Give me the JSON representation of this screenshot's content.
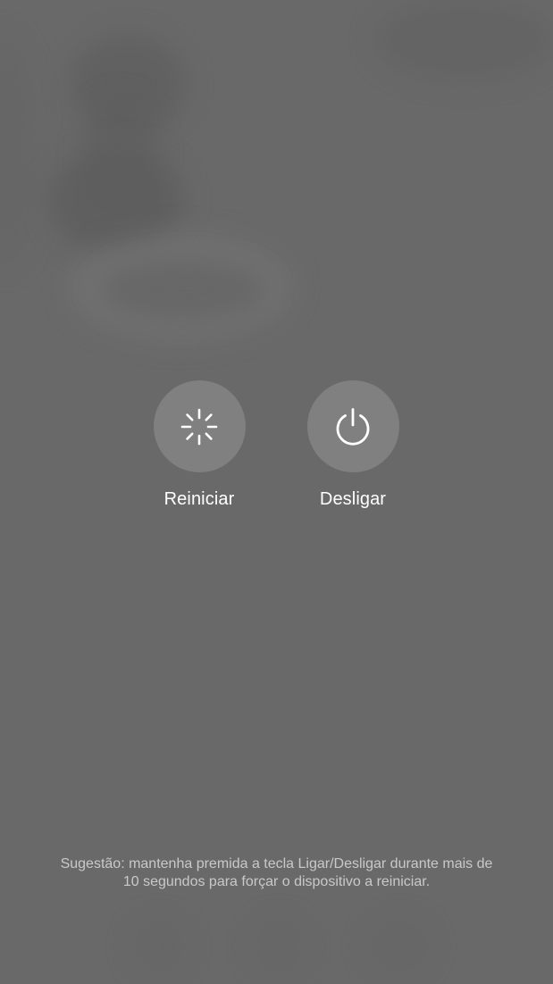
{
  "actions": {
    "restart": {
      "label": "Reiniciar",
      "icon": "restart-spinner-icon"
    },
    "shutdown": {
      "label": "Desligar",
      "icon": "power-icon"
    }
  },
  "hint": {
    "line1": "Sugestão: mantenha premida a tecla Ligar/Desligar durante mais de",
    "line2": "10 segundos para forçar o dispositivo a reiniciar."
  },
  "colors": {
    "overlay": "#696969",
    "button_circle": "#808080",
    "label_text": "#ffffff",
    "hint_text": "#c9c9c9"
  }
}
